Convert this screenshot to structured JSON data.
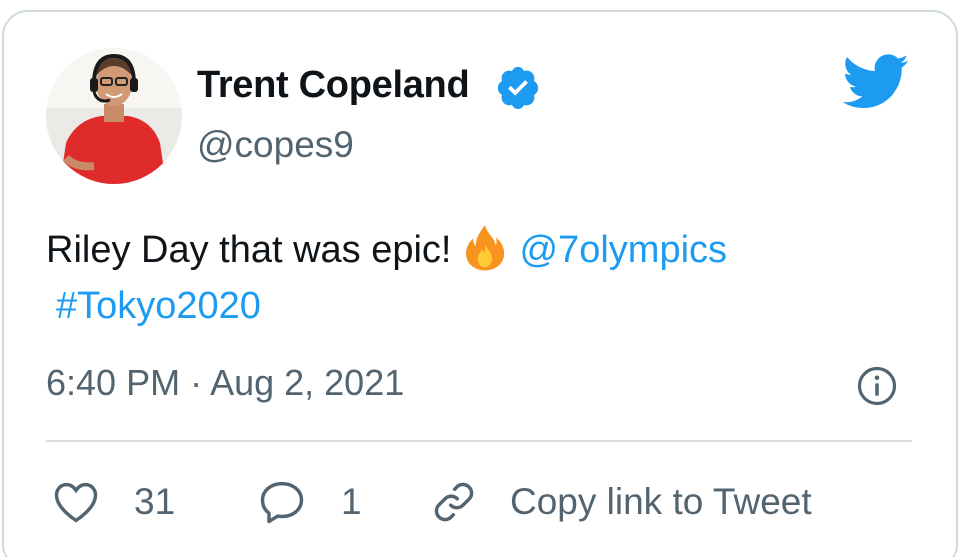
{
  "tweet": {
    "author": {
      "display_name": "Trent Copeland",
      "handle": "@copes9",
      "verified": true,
      "avatar_icon": "profile-photo"
    },
    "brand_icon": "twitter-bird-icon",
    "brand_color": "#1d9bf0",
    "text_before_emoji": "Riley Day that was epic!",
    "emoji": "fire-emoji",
    "mention": "@7olympics",
    "hashtag": "#Tokyo2020",
    "timestamp": "6:40 PM · Aug 2, 2021",
    "actions": {
      "like_count": "31",
      "reply_count": "1",
      "copy_link_label": "Copy link to Tweet"
    }
  }
}
